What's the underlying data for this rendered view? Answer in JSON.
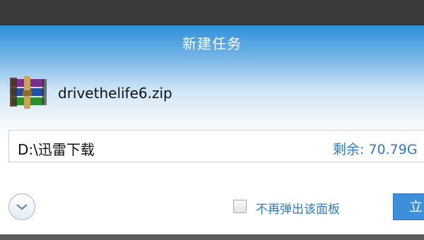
{
  "dialog": {
    "title": "新建任务"
  },
  "file": {
    "name": "drivethelife6.zip",
    "icon": "winrar-archive-icon"
  },
  "path": {
    "value": "D:\\迅雷下载",
    "space_label": "剩余: 70.79G"
  },
  "footer": {
    "expand_icon": "chevron-down-icon",
    "checkbox_label": "不再弹出该面板",
    "checkbox_checked": false,
    "confirm_label": "立"
  },
  "colors": {
    "title_bar": "#2e8fd8",
    "link": "#2c7bc8",
    "button": "#3d8fd9"
  }
}
